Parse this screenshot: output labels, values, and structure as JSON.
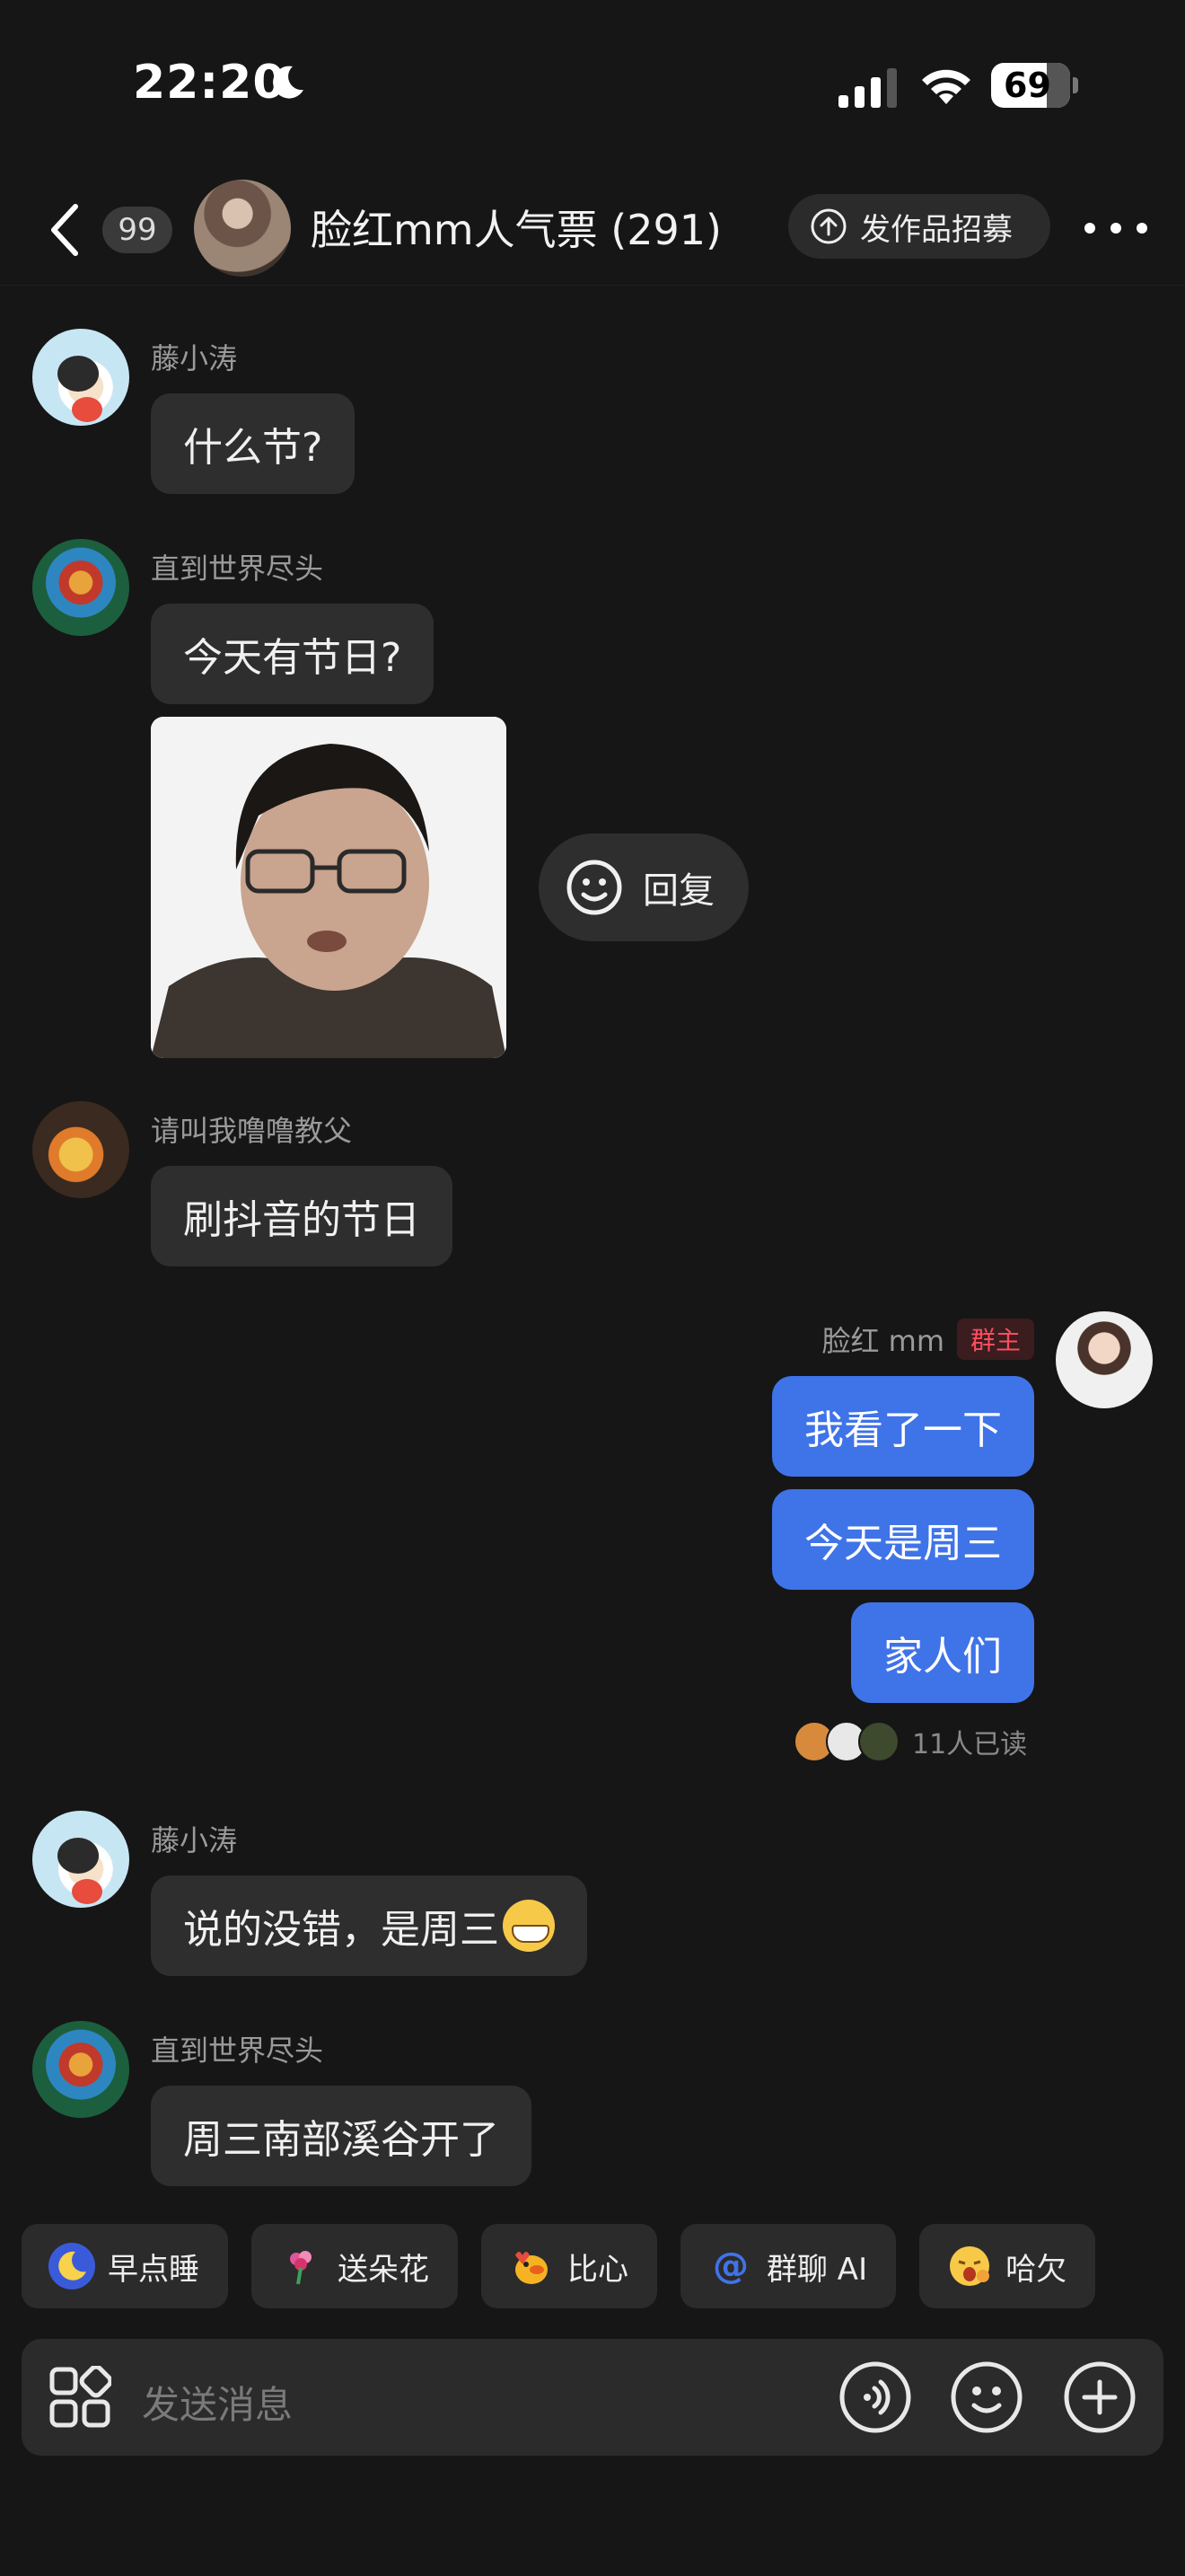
{
  "status_bar": {
    "time": "22:20",
    "battery": "69"
  },
  "header": {
    "unread_count": "99",
    "group_title": "脸红mm人气票 (291)",
    "recruit_label": "发作品招募"
  },
  "messages": [
    {
      "sender": "藤小涛",
      "text": "什么节?"
    },
    {
      "sender": "直到世界尽头",
      "text": "今天有节日?"
    },
    {
      "sender": "请叫我噜噜教父",
      "text": "刷抖音的节日"
    },
    {
      "sender": "脸红 mm",
      "badge": "群主",
      "texts": [
        "我看了一下",
        "今天是周三",
        "家人们"
      ],
      "read_receipt": "11人已读"
    },
    {
      "sender": "藤小涛",
      "text": "说的没错，是周三"
    },
    {
      "sender": "直到世界尽头",
      "text": "周三南部溪谷开了"
    }
  ],
  "reply_button_label": "回复",
  "quick_replies": [
    {
      "label": "早点睡",
      "icon": "moon-sleep-icon",
      "color": "#3a5bd9"
    },
    {
      "label": "送朵花",
      "icon": "flower-icon",
      "color": "#e0559b"
    },
    {
      "label": "比心",
      "icon": "duck-heart-icon",
      "color": "#f5b324"
    },
    {
      "label": "群聊 AI",
      "icon": "at-icon",
      "color": "#3f73e8"
    },
    {
      "label": "哈欠",
      "icon": "yawn-icon",
      "color": "#f7c948"
    }
  ],
  "input": {
    "placeholder": "发送消息"
  },
  "colors": {
    "background": "#161616",
    "bubble_other": "#2e2e2e",
    "bubble_mine": "#3f73e8",
    "owner_badge": "#ff4d5e"
  }
}
